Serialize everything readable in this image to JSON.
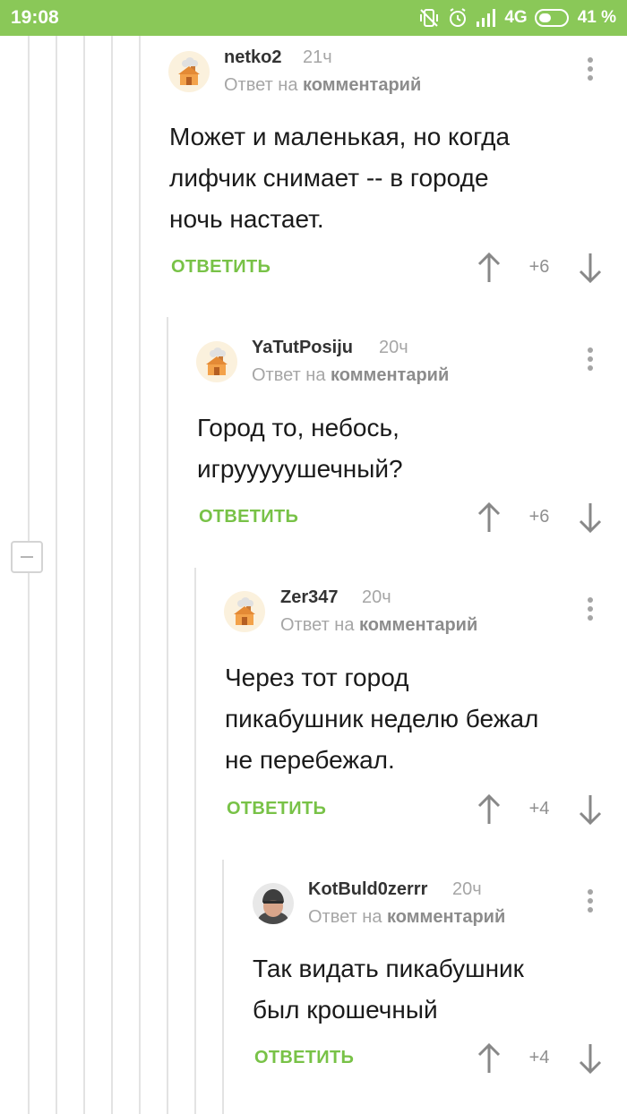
{
  "status": {
    "time": "19:08",
    "network": "4G",
    "battery": "41 %"
  },
  "comments": [
    {
      "author": "netko2",
      "time": "21ч",
      "reply_prefix": "Ответ на ",
      "reply_link": "комментарий",
      "lines": [
        "Может и маленькая, но когда",
        "лифчик снимает -- в городе",
        "ночь настает."
      ],
      "reply_label": "ОТВЕТИТЬ",
      "score": "+6",
      "avatar": "default-avatar"
    },
    {
      "author": "YaTutPosiju",
      "time": "20ч",
      "reply_prefix": "Ответ на ",
      "reply_link": "комментарий",
      "lines": [
        "Город то, небось,",
        "игрууууушечный?"
      ],
      "reply_label": "ОТВЕТИТЬ",
      "score": "+6",
      "avatar": "default-avatar"
    },
    {
      "author": "Zer347",
      "time": "20ч",
      "reply_prefix": "Ответ на ",
      "reply_link": "комментарий",
      "lines": [
        "Через тот город",
        "пикабушник неделю бежал",
        "не перебежал."
      ],
      "reply_label": "ОТВЕТИТЬ",
      "score": "+4",
      "avatar": "default-avatar"
    },
    {
      "author": "KotBuld0zerrr",
      "time": "20ч",
      "reply_prefix": "Ответ на ",
      "reply_link": "комментарий",
      "lines": [
        "Так видать пикабушник",
        "был крошечный"
      ],
      "reply_label": "ОТВЕТИТЬ",
      "score": "+4",
      "avatar": "user-photo-avatar"
    }
  ],
  "colors": {
    "status_bar": "#8ac858",
    "accent": "#78c247",
    "meta_text": "#a6a6a6"
  }
}
